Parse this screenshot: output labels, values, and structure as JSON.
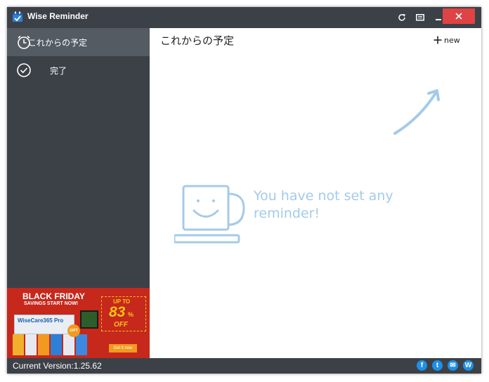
{
  "window": {
    "title": "Wise Reminder"
  },
  "sidebar": {
    "items": [
      {
        "label": "これからの予定",
        "icon": "clock-icon",
        "active": true
      },
      {
        "label": "完了",
        "icon": "check-circle-icon",
        "active": false
      }
    ]
  },
  "ad": {
    "headline": "BLACK FRIDAY",
    "subline": "SAVINGS START NOW!",
    "product": "WiseCare365 Pro",
    "badge_top": "UP TO",
    "badge_percent": "83",
    "badge_pct_sign": "%",
    "badge_off": "OFF",
    "gift": "GIFT",
    "cta": "Get it now"
  },
  "main": {
    "title": "これからの予定",
    "new_label": "new",
    "empty_message": "You have not set any\nreminder!"
  },
  "status": {
    "version": "Current Version:1.25.62",
    "social": [
      {
        "icon": "facebook-icon",
        "glyph": "f"
      },
      {
        "icon": "twitter-icon",
        "glyph": "t"
      },
      {
        "icon": "email-icon",
        "glyph": "✉"
      },
      {
        "icon": "wise-icon",
        "glyph": "W"
      }
    ]
  },
  "colors": {
    "chrome": "#3c4148",
    "active_item": "#555b63",
    "close": "#e04343",
    "accent_light_blue": "#a4cbe8",
    "ad_red": "#c6281c",
    "ad_yellow": "#f7c417"
  }
}
